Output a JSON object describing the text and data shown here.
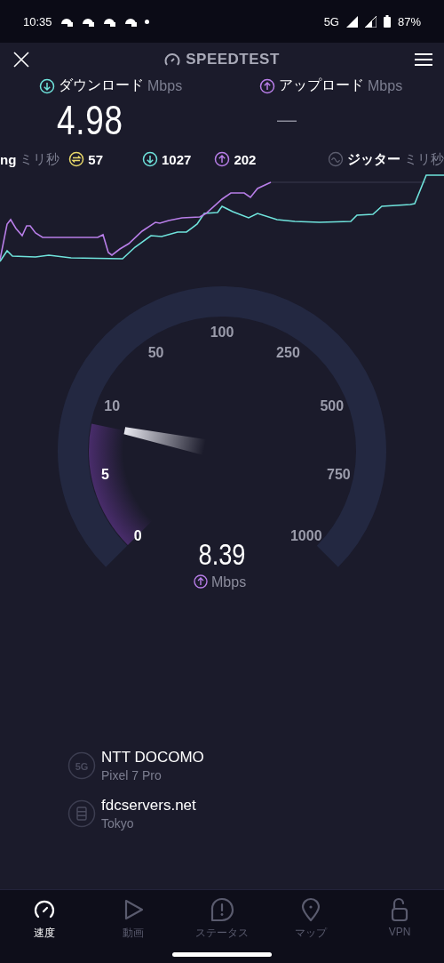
{
  "status_bar": {
    "time": "10:35",
    "network": "5G",
    "battery": "87%"
  },
  "header": {
    "title": "SPEEDTEST"
  },
  "download": {
    "label": "ダウンロード",
    "unit": "Mbps",
    "value": "4.98"
  },
  "upload": {
    "label": "アップロード",
    "unit": "Mbps",
    "value": "—"
  },
  "ping": {
    "label": "ng",
    "unit": "ミリ秒",
    "idle": "57",
    "download": "1027",
    "upload": "202"
  },
  "jitter": {
    "label": "ジッター",
    "unit": "ミリ秒"
  },
  "gauge": {
    "ticks": [
      "0",
      "5",
      "10",
      "50",
      "100",
      "250",
      "500",
      "750",
      "1000"
    ],
    "value": "8.39",
    "unit": "Mbps"
  },
  "connection": [
    {
      "kind": "network",
      "badge": "5G",
      "title": "NTT DOCOMO",
      "subtitle": "Pixel 7 Pro"
    },
    {
      "kind": "server",
      "title": "fdcservers.net",
      "subtitle": "Tokyo"
    }
  ],
  "nav": [
    {
      "kind": "speed",
      "label": "速度",
      "selected": true
    },
    {
      "kind": "video",
      "label": "動画",
      "selected": false
    },
    {
      "kind": "status",
      "label": "ステータス",
      "selected": false
    },
    {
      "kind": "map",
      "label": "マップ",
      "selected": false
    },
    {
      "kind": "vpn",
      "label": "VPN",
      "selected": false
    }
  ]
}
